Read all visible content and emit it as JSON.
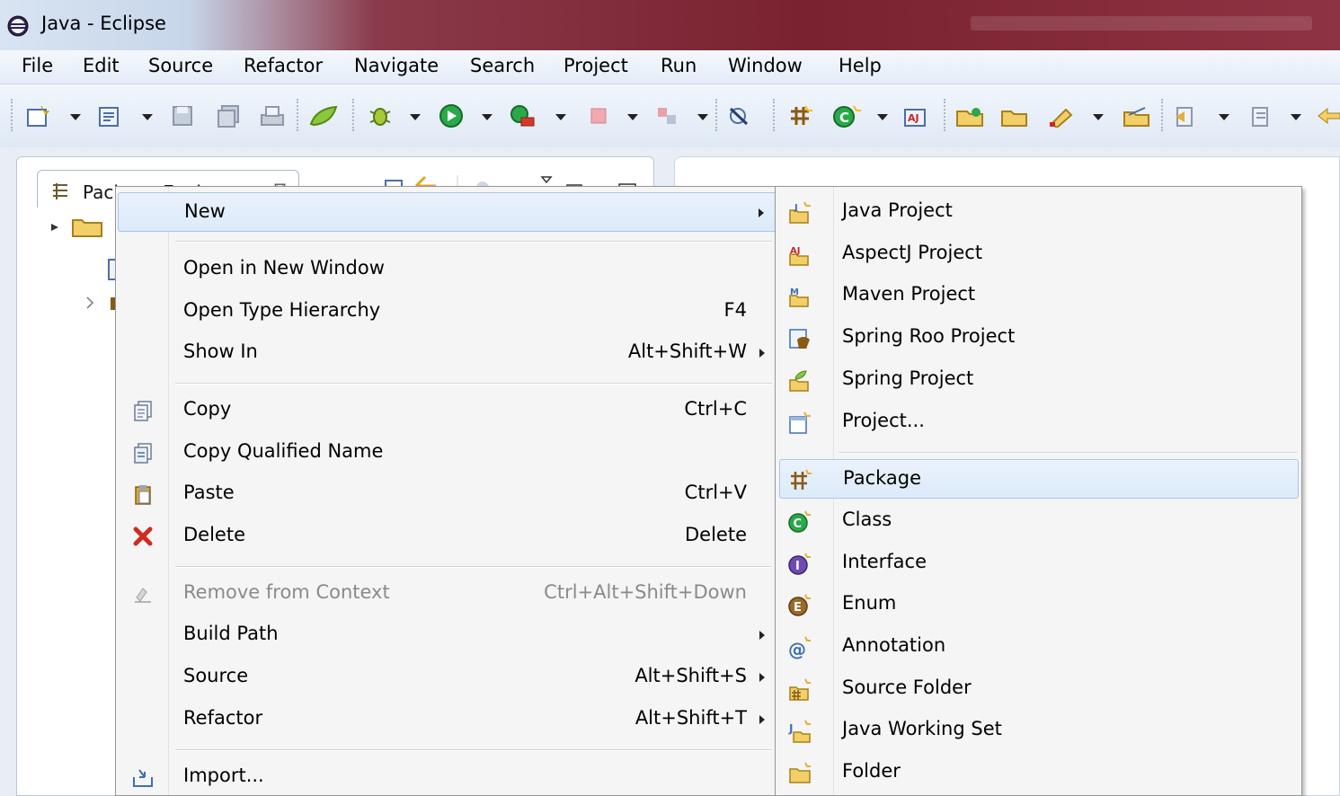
{
  "window": {
    "title": "Java - Eclipse"
  },
  "menubar": {
    "items": [
      "File",
      "Edit",
      "Source",
      "Refactor",
      "Navigate",
      "Search",
      "Project",
      "Run",
      "Window",
      "Help"
    ]
  },
  "package_explorer": {
    "tab_label": "Package Explorer",
    "tab_close": "⊠"
  },
  "context_menu": {
    "items": [
      {
        "label": "New",
        "accel": "",
        "submenu": true,
        "icon": "none",
        "highlighted": true
      },
      {
        "label": "Open in New Window",
        "accel": "",
        "submenu": false,
        "icon": "none"
      },
      {
        "label": "Open Type Hierarchy",
        "accel": "F4",
        "submenu": false,
        "icon": "none"
      },
      {
        "label": "Show In",
        "accel": "Alt+Shift+W",
        "submenu": true,
        "icon": "none"
      },
      {
        "label": "Copy",
        "accel": "Ctrl+C",
        "submenu": false,
        "icon": "copy-icon"
      },
      {
        "label": "Copy Qualified Name",
        "accel": "",
        "submenu": false,
        "icon": "copy-qualified-name-icon"
      },
      {
        "label": "Paste",
        "accel": "Ctrl+V",
        "submenu": false,
        "icon": "paste-icon"
      },
      {
        "label": "Delete",
        "accel": "Delete",
        "submenu": false,
        "icon": "delete-icon"
      },
      {
        "label": "Remove from Context",
        "accel": "Ctrl+Alt+Shift+Down",
        "submenu": false,
        "icon": "remove-from-context-icon",
        "disabled": true
      },
      {
        "label": "Build Path",
        "accel": "",
        "submenu": true,
        "icon": "none"
      },
      {
        "label": "Source",
        "accel": "Alt+Shift+S",
        "submenu": true,
        "icon": "none"
      },
      {
        "label": "Refactor",
        "accel": "Alt+Shift+T",
        "submenu": true,
        "icon": "none"
      },
      {
        "label": "Import...",
        "accel": "",
        "submenu": false,
        "icon": "import-icon"
      }
    ]
  },
  "new_submenu": {
    "items": [
      {
        "label": "Java Project",
        "icon": "java-project-icon"
      },
      {
        "label": "AspectJ Project",
        "icon": "aspectj-project-icon"
      },
      {
        "label": "Maven Project",
        "icon": "maven-project-icon"
      },
      {
        "label": "Spring Roo Project",
        "icon": "spring-roo-project-icon"
      },
      {
        "label": "Spring Project",
        "icon": "spring-project-icon"
      },
      {
        "label": "Project...",
        "icon": "project-icon"
      },
      {
        "label": "Package",
        "icon": "package-icon",
        "highlighted": true
      },
      {
        "label": "Class",
        "icon": "class-icon"
      },
      {
        "label": "Interface",
        "icon": "interface-icon"
      },
      {
        "label": "Enum",
        "icon": "enum-icon"
      },
      {
        "label": "Annotation",
        "icon": "annotation-icon"
      },
      {
        "label": "Source Folder",
        "icon": "source-folder-icon"
      },
      {
        "label": "Java Working Set",
        "icon": "java-working-set-icon"
      },
      {
        "label": "Folder",
        "icon": "folder-icon"
      }
    ]
  },
  "colors": {
    "highlight": "#dceaf9",
    "menu_bg": "#f5f5f5",
    "titlebar_accent": "#7a2230"
  }
}
